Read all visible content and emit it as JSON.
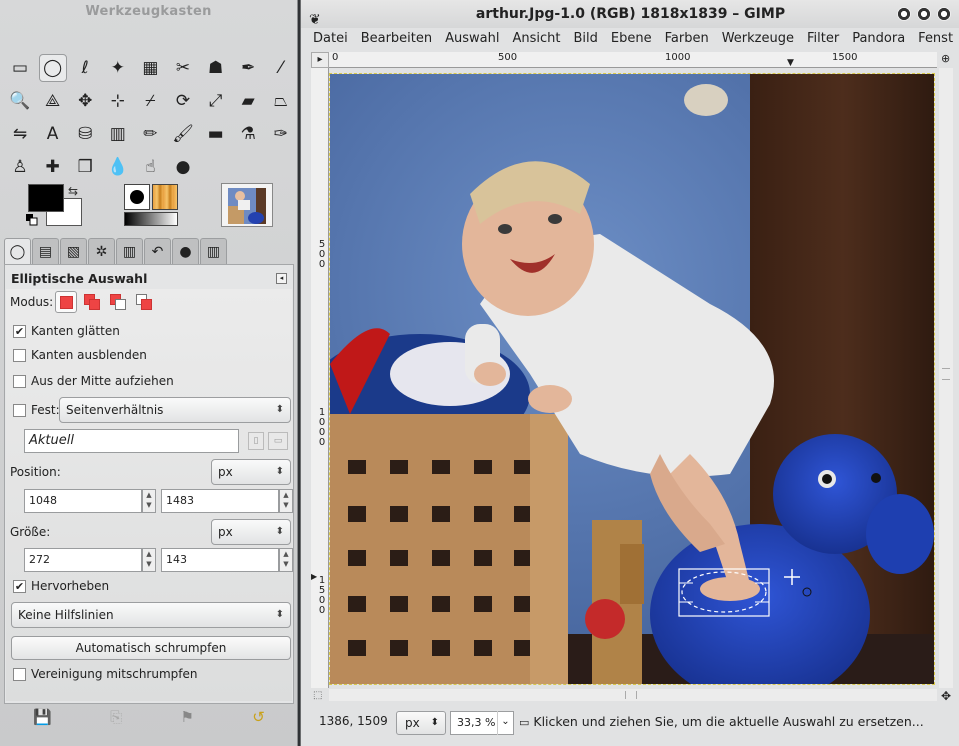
{
  "toolbox": {
    "title": "Werkzeugkasten",
    "tools": [
      {
        "name": "rect-select-icon",
        "glyph": "▭"
      },
      {
        "name": "ellipse-select-icon",
        "glyph": "◯",
        "active": true
      },
      {
        "name": "free-select-icon",
        "glyph": "ℓ"
      },
      {
        "name": "fuzzy-select-icon",
        "glyph": "✦"
      },
      {
        "name": "select-by-color-icon",
        "glyph": "▦"
      },
      {
        "name": "scissors-select-icon",
        "glyph": "✂"
      },
      {
        "name": "foreground-select-icon",
        "glyph": "☗"
      },
      {
        "name": "paths-icon",
        "glyph": "✒"
      },
      {
        "name": "color-picker-icon",
        "glyph": "⁄"
      },
      {
        "name": "zoom-icon",
        "glyph": "🔍"
      },
      {
        "name": "measure-icon",
        "glyph": "⟁"
      },
      {
        "name": "move-icon",
        "glyph": "✥"
      },
      {
        "name": "align-icon",
        "glyph": "⊹"
      },
      {
        "name": "crop-icon",
        "glyph": "⌿"
      },
      {
        "name": "rotate-icon",
        "glyph": "⟳"
      },
      {
        "name": "scale-icon",
        "glyph": "⤢"
      },
      {
        "name": "shear-icon",
        "glyph": "▰"
      },
      {
        "name": "perspective-icon",
        "glyph": "⏢"
      },
      {
        "name": "flip-icon",
        "glyph": "⇋"
      },
      {
        "name": "text-icon",
        "glyph": "A"
      },
      {
        "name": "bucket-fill-icon",
        "glyph": "⛁"
      },
      {
        "name": "blend-icon",
        "glyph": "▥"
      },
      {
        "name": "pencil-icon",
        "glyph": "✏"
      },
      {
        "name": "paintbrush-icon",
        "glyph": "🖌"
      },
      {
        "name": "eraser-icon",
        "glyph": "▬"
      },
      {
        "name": "airbrush-icon",
        "glyph": "⚗"
      },
      {
        "name": "ink-icon",
        "glyph": "✑"
      },
      {
        "name": "clone-icon",
        "glyph": "♙"
      },
      {
        "name": "heal-icon",
        "glyph": "✚"
      },
      {
        "name": "perspective-clone-icon",
        "glyph": "❒"
      },
      {
        "name": "blur-icon",
        "glyph": "💧"
      },
      {
        "name": "smudge-icon",
        "glyph": "☝"
      },
      {
        "name": "dodge-burn-icon",
        "glyph": "●"
      }
    ],
    "dock_tabs": [
      {
        "name": "tab-tool-options-icon",
        "glyph": "◯"
      },
      {
        "name": "tab-device-status-icon",
        "glyph": "▤"
      },
      {
        "name": "tab-layers-icon",
        "glyph": "▧"
      },
      {
        "name": "tab-brushes-icon",
        "glyph": "✲"
      },
      {
        "name": "tab-gradients-icon",
        "glyph": "▥"
      },
      {
        "name": "tab-undo-icon",
        "glyph": "↶"
      },
      {
        "name": "tab-brush-icon",
        "glyph": "●"
      },
      {
        "name": "tab-patterns-icon",
        "glyph": "▥"
      }
    ]
  },
  "tool_options": {
    "title": "Elliptische Auswahl",
    "mode_label": "Modus:",
    "antialias_label": "Kanten glätten",
    "antialias_checked": "✔",
    "feather_label": "Kanten ausblenden",
    "from_center_label": "Aus der Mitte aufziehen",
    "fixed_label": "Fest:",
    "fixed_value": "Seitenverhältnis",
    "current_value": "Aktuell",
    "position_label": "Position:",
    "position_unit": "px",
    "position_x": "1048",
    "position_y": "1483",
    "size_label": "Größe:",
    "size_unit": "px",
    "size_w": "272",
    "size_h": "143",
    "highlight_label": "Hervorheben",
    "highlight_checked": "✔",
    "guides_value": "Keine Hilfslinien",
    "auto_shrink_label": "Automatisch schrumpfen",
    "shrink_merged_label": "Vereinigung mitschrumpfen"
  },
  "image_window": {
    "title": "arthur.Jpg-1.0 (RGB) 1818x1839 – GIMP",
    "menu": [
      "Datei",
      "Bearbeiten",
      "Auswahl",
      "Ansicht",
      "Bild",
      "Ebene",
      "Farben",
      "Werkzeuge",
      "Filter",
      "Pandora",
      "Fenst"
    ],
    "ruler_labels": [
      "0",
      "500",
      "1000",
      "1500"
    ],
    "vruler_labels": [
      "500",
      "1000",
      "1500"
    ],
    "status_coords": "1386, 1509",
    "status_unit": "px",
    "status_zoom": "33,3 %",
    "status_message": "Klicken und ziehen Sie, um die aktuelle Auswahl zu ersetzen..."
  },
  "colors": {
    "foreground": "#000000",
    "background": "#ffffff",
    "wall": "#5576ae",
    "wood_dark": "#3d2216",
    "crate": "#b98a5a",
    "dog": "#1e3fb0"
  }
}
